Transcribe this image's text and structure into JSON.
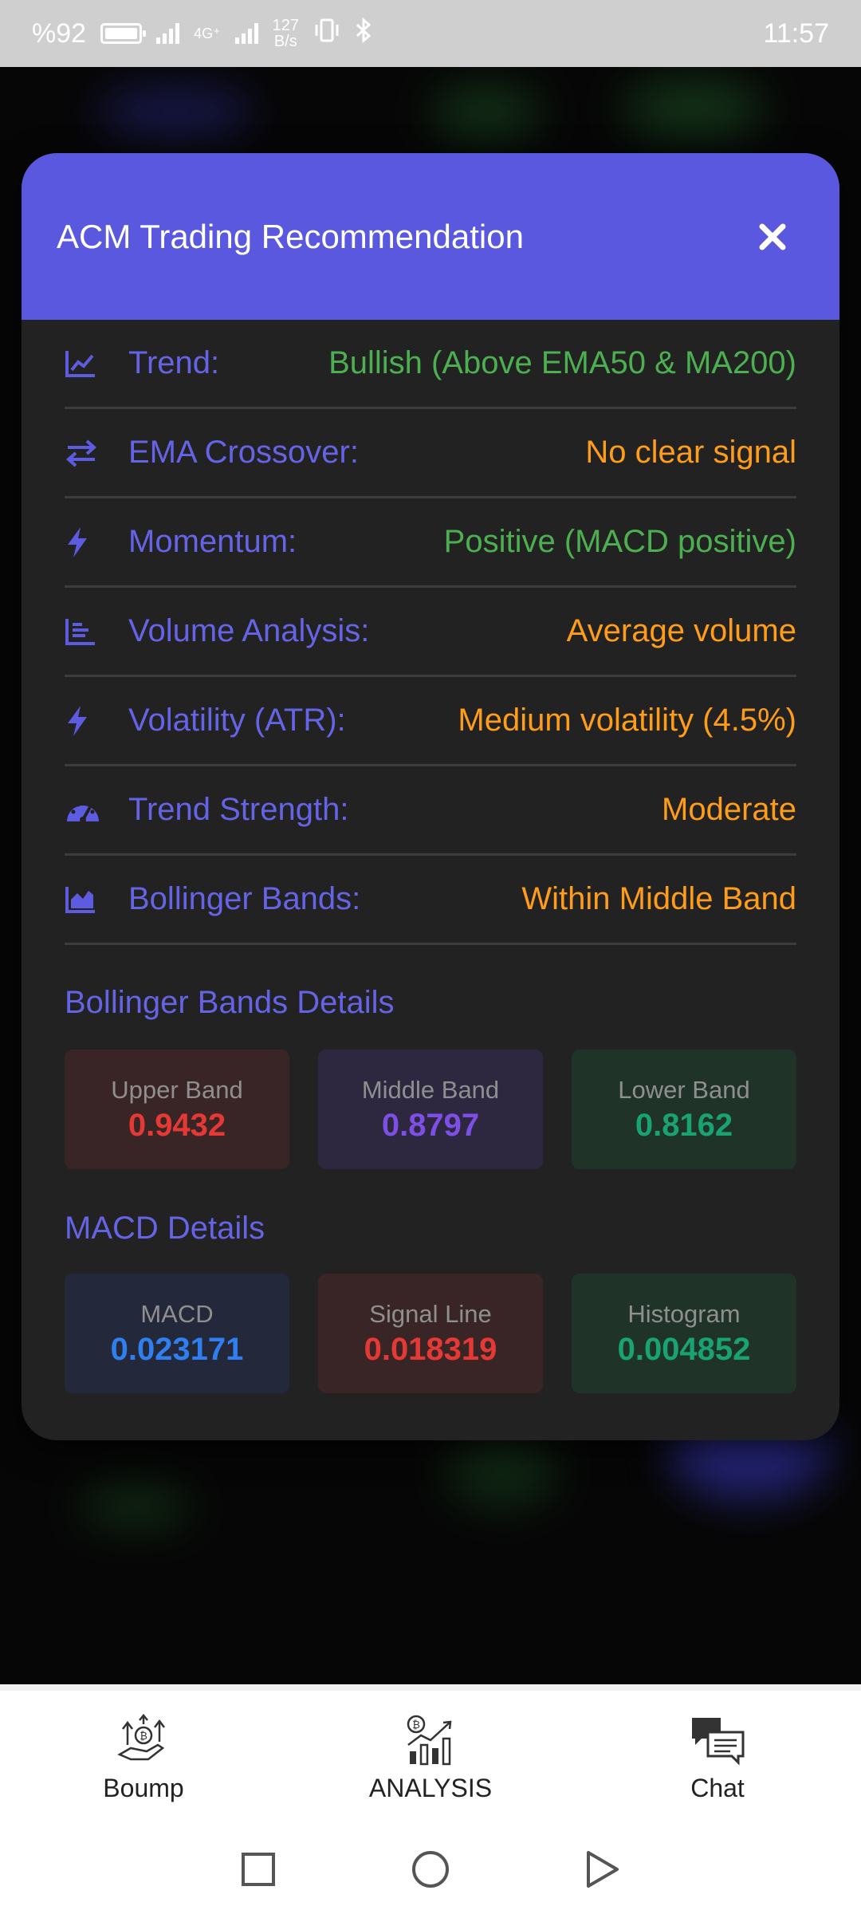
{
  "status_bar": {
    "battery": "%92",
    "network_gen": "4G⁺",
    "speed_value": "127",
    "speed_unit": "B/s",
    "time": "11:57"
  },
  "modal": {
    "title": "ACM Trading Recommendation",
    "rows": [
      {
        "icon": "chart-line-icon",
        "label": "Trend:",
        "value": "Bullish (Above EMA50 & MA200)",
        "tone": "green"
      },
      {
        "icon": "exchange-arrows-icon",
        "label": "EMA Crossover:",
        "value": "No clear signal",
        "tone": "orange"
      },
      {
        "icon": "bolt-icon",
        "label": "Momentum:",
        "value": "Positive (MACD positive)",
        "tone": "green"
      },
      {
        "icon": "bar-chart-icon",
        "label": "Volume Analysis:",
        "value": "Average volume",
        "tone": "orange"
      },
      {
        "icon": "bolt-icon",
        "label": "Volatility (ATR):",
        "value": "Medium volatility (4.5%)",
        "tone": "orange"
      },
      {
        "icon": "gauge-icon",
        "label": "Trend Strength:",
        "value": "Moderate",
        "tone": "orange"
      },
      {
        "icon": "area-chart-icon",
        "label": "Bollinger Bands:",
        "value": "Within Middle Band",
        "tone": "orange"
      }
    ],
    "bollinger": {
      "title": "Bollinger Bands Details",
      "upper_label": "Upper Band",
      "upper_value": "0.9432",
      "middle_label": "Middle Band",
      "middle_value": "0.8797",
      "lower_label": "Lower Band",
      "lower_value": "0.8162"
    },
    "macd": {
      "title": "MACD Details",
      "macd_label": "MACD",
      "macd_value": "0.023171",
      "signal_label": "Signal Line",
      "signal_value": "0.018319",
      "histogram_label": "Histogram",
      "histogram_value": "0.004852"
    }
  },
  "bottom_nav": {
    "items": [
      {
        "label": "Boump"
      },
      {
        "label": "ANALYSIS"
      },
      {
        "label": "Chat"
      }
    ]
  },
  "colors": {
    "header": "#5b58e0",
    "label": "#6563e6",
    "positive": "#4caf50",
    "neutral": "#ff9c1a"
  }
}
